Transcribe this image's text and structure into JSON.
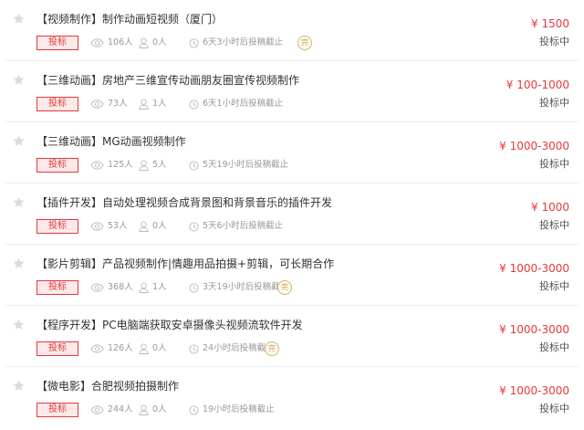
{
  "accent_color": "#e4393c",
  "listings": [
    {
      "title": "【视频制作】制作动画短视频（厦门）",
      "badge": "投标",
      "views": "106人",
      "bidders": "0人",
      "deadline": "6天3小时后投稿截止",
      "completed_mark": "完",
      "price": "¥ 1500",
      "status": "投标中"
    },
    {
      "title": "【三维动画】房地产三维宣传动画朋友圈宣传视频制作",
      "badge": "投标",
      "views": "73人",
      "bidders": "1人",
      "deadline": "6天1小时后投稿截止",
      "completed_mark": "",
      "price": "¥ 100-1000",
      "status": "投标中"
    },
    {
      "title": "【三维动画】MG动画视频制作",
      "badge": "投标",
      "views": "125人",
      "bidders": "5人",
      "deadline": "5天19小时后投稿截止",
      "completed_mark": "",
      "price": "¥ 1000-3000",
      "status": "投标中"
    },
    {
      "title": "【插件开发】自动处理视频合成背景图和背景音乐的插件开发",
      "badge": "投标",
      "views": "53人",
      "bidders": "0人",
      "deadline": "5天6小时后投稿截止",
      "completed_mark": "",
      "price": "¥ 1000",
      "status": "投标中"
    },
    {
      "title": "【影片剪辑】产品视频制作|情趣用品拍摄+剪辑，可长期合作",
      "badge": "投标",
      "views": "368人",
      "bidders": "1人",
      "deadline": "3天19小时后投稿截止",
      "completed_mark": "完",
      "price": "¥ 1000-3000",
      "status": "投标中"
    },
    {
      "title": "【程序开发】PC电脑端获取安卓摄像头视频流软件开发",
      "badge": "投标",
      "views": "126人",
      "bidders": "0人",
      "deadline": "24小时后投稿截止",
      "completed_mark": "完",
      "price": "¥ 1000-3000",
      "status": "投标中"
    },
    {
      "title": "【微电影】合肥视频拍摄制作",
      "badge": "投标",
      "views": "244人",
      "bidders": "0人",
      "deadline": "19小时后投稿截止",
      "completed_mark": "",
      "price": "¥ 1000-3000",
      "status": "投标中"
    }
  ]
}
